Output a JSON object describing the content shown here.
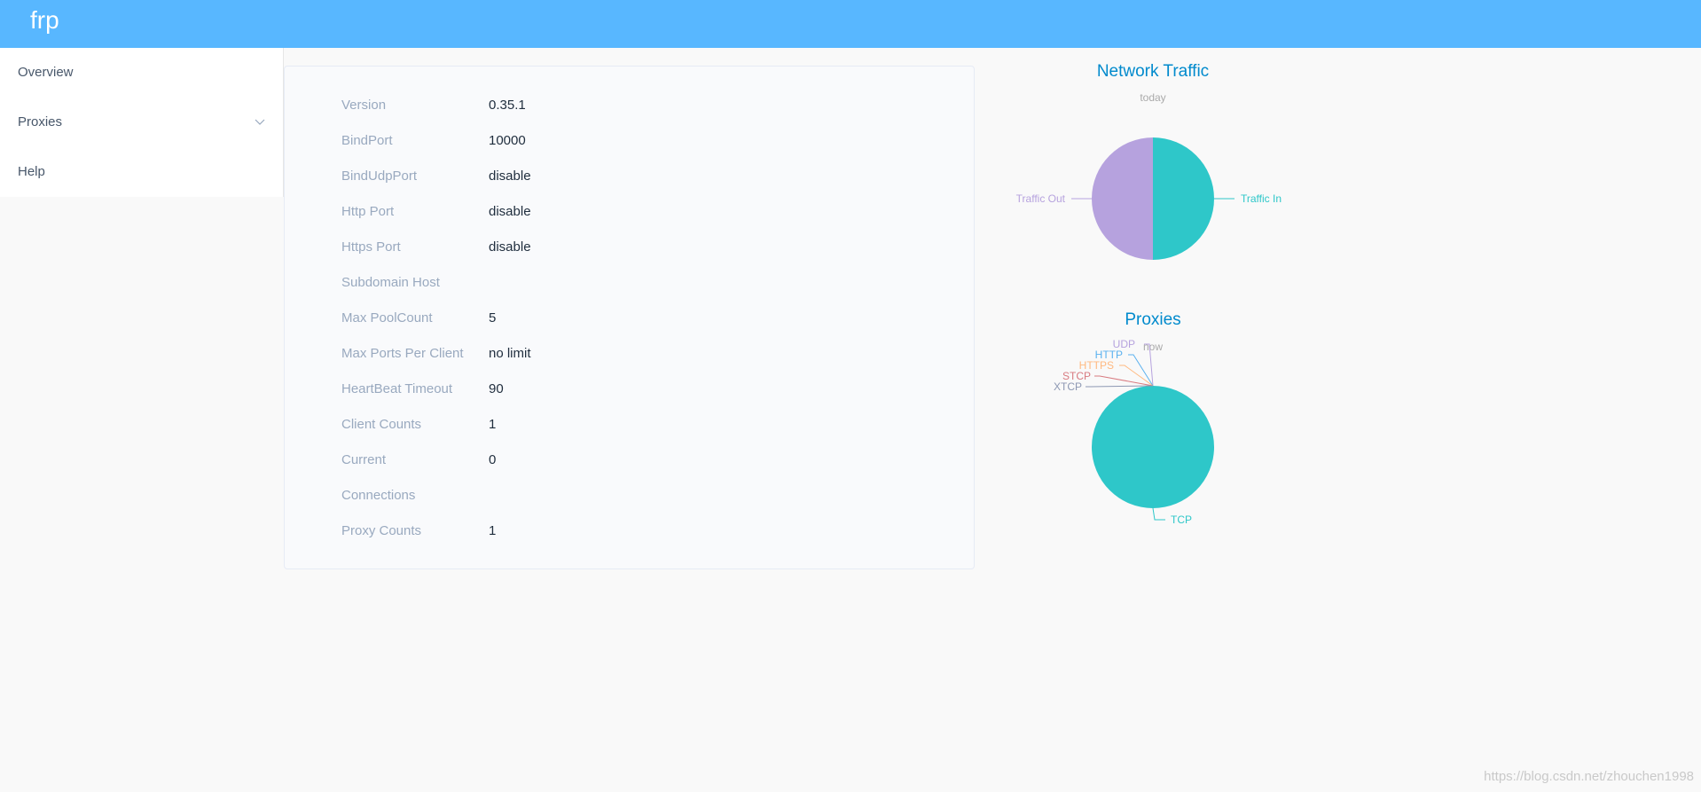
{
  "app": {
    "title": "frp"
  },
  "sidebar": {
    "items": [
      {
        "label": "Overview"
      },
      {
        "label": "Proxies"
      },
      {
        "label": "Help"
      }
    ]
  },
  "server_info": [
    {
      "key": "Version",
      "value": "0.35.1"
    },
    {
      "key": "BindPort",
      "value": "10000"
    },
    {
      "key": "BindUdpPort",
      "value": "disable"
    },
    {
      "key": "Http Port",
      "value": "disable"
    },
    {
      "key": "Https Port",
      "value": "disable"
    },
    {
      "key": "Subdomain Host",
      "value": ""
    },
    {
      "key": "Max PoolCount",
      "value": "5"
    },
    {
      "key": "Max Ports Per Client",
      "value": "no limit"
    },
    {
      "key": "HeartBeat Timeout",
      "value": "90"
    },
    {
      "key": "Client Counts",
      "value": "1"
    },
    {
      "key": "Current",
      "value": "0"
    },
    {
      "key": "Connections",
      "value": ""
    },
    {
      "key": "Proxy Counts",
      "value": "1"
    }
  ],
  "watermark": "https://blog.csdn.net/zhouchen1998",
  "colors": {
    "header": "#58b7ff",
    "traffic_in": "#2ec7c9",
    "traffic_out": "#b6a2de",
    "title": "#008acd"
  },
  "chart_data": [
    {
      "type": "pie",
      "title": "Network Traffic",
      "subtitle": "today",
      "categories": [
        "Traffic In",
        "Traffic Out"
      ],
      "values": [
        50,
        50
      ],
      "colors": [
        "#2ec7c9",
        "#b6a2de"
      ]
    },
    {
      "type": "pie",
      "title": "Proxies",
      "subtitle": "now",
      "categories": [
        "TCP",
        "UDP",
        "HTTP",
        "HTTPS",
        "STCP",
        "XTCP"
      ],
      "values": [
        1,
        0,
        0,
        0,
        0,
        0
      ],
      "colors": [
        "#2ec7c9",
        "#b6a2de",
        "#5ab1ef",
        "#ffb980",
        "#d87a80",
        "#8d98b3"
      ]
    }
  ]
}
